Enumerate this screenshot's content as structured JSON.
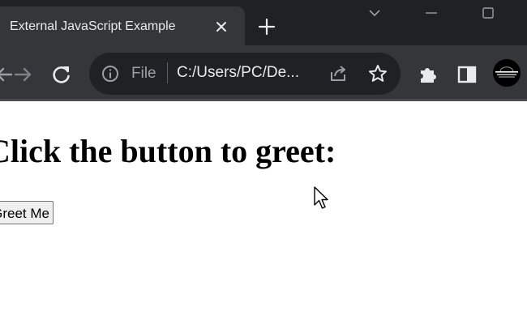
{
  "browser": {
    "tab": {
      "title": "External JavaScript Example"
    },
    "address_bar": {
      "chip_label": "File",
      "url": "C:/Users/PC/De..."
    },
    "icons": {
      "tab_close": "close-icon",
      "new_tab": "plus-icon",
      "back": "back-arrow-icon",
      "forward": "forward-arrow-icon",
      "reload": "reload-icon",
      "site_info": "info-icon",
      "share": "share-icon",
      "bookmark": "star-icon",
      "extensions": "puzzle-icon",
      "side_panel": "side-panel-icon",
      "profile": "avatar"
    },
    "colors": {
      "tabstrip": "#202124",
      "toolbar": "#35363a",
      "omnibox": "#202124",
      "text": "#e8eaed"
    }
  },
  "page": {
    "heading": "Click the button to greet:",
    "button_label": "Greet Me",
    "background": "#ffffff"
  }
}
